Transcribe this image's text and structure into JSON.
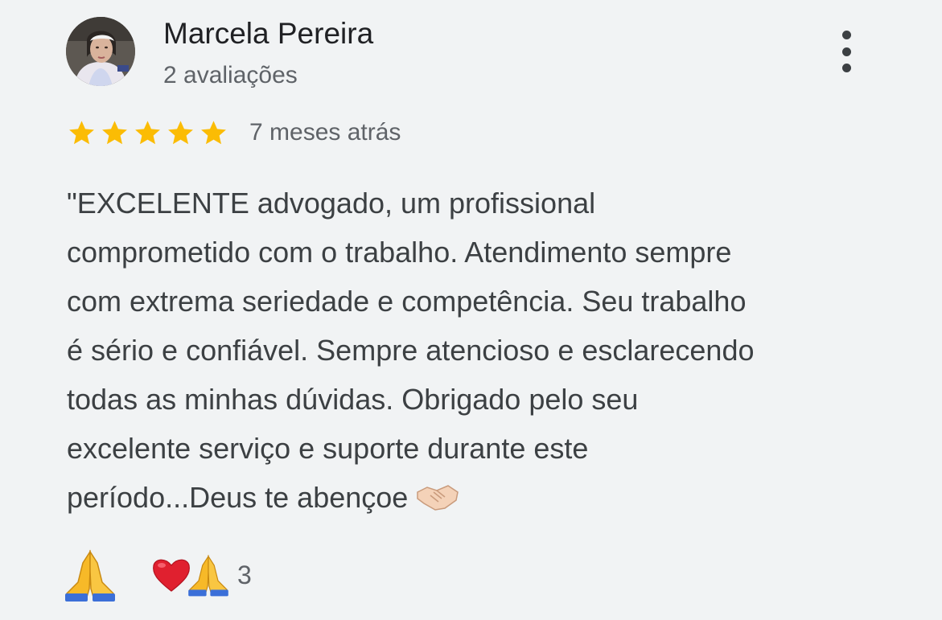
{
  "review": {
    "author_name": "Marcela Pereira",
    "author_meta": "2 avaliações",
    "rating": 5,
    "max_rating": 5,
    "date": "7 meses atrás",
    "text_lines": [
      "\"EXCELENTE advogado, um profissional",
      "comprometido com o trabalho. Atendimento sempre",
      "com extrema seriedade e competência. Seu trabalho",
      "é sério e confiável. Sempre atencioso e esclarecendo",
      "todas as minhas dúvidas. Obrigado pelo seu",
      "excelente serviço e suporte durante este",
      "período...Deus te abençoe"
    ],
    "text_end_icon": "handshake-emoji"
  },
  "reactions": {
    "react_icon": "folded-hands-emoji",
    "summary_icons": [
      "red-heart-emoji",
      "folded-hands-emoji"
    ],
    "count": "3"
  },
  "colors": {
    "background": "#f1f3f4",
    "star": "#fbbc04",
    "primary_text": "#202124",
    "secondary_text": "#5f6368"
  }
}
